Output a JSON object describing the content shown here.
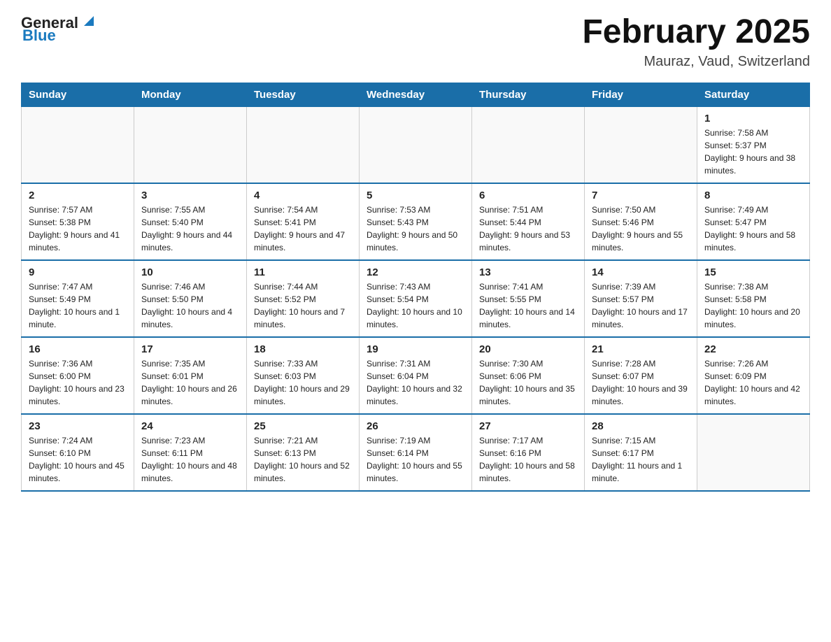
{
  "header": {
    "logo_general": "General",
    "logo_blue": "Blue",
    "title": "February 2025",
    "subtitle": "Mauraz, Vaud, Switzerland"
  },
  "weekdays": [
    "Sunday",
    "Monday",
    "Tuesday",
    "Wednesday",
    "Thursday",
    "Friday",
    "Saturday"
  ],
  "weeks": [
    [
      {
        "day": "",
        "info": ""
      },
      {
        "day": "",
        "info": ""
      },
      {
        "day": "",
        "info": ""
      },
      {
        "day": "",
        "info": ""
      },
      {
        "day": "",
        "info": ""
      },
      {
        "day": "",
        "info": ""
      },
      {
        "day": "1",
        "info": "Sunrise: 7:58 AM\nSunset: 5:37 PM\nDaylight: 9 hours and 38 minutes."
      }
    ],
    [
      {
        "day": "2",
        "info": "Sunrise: 7:57 AM\nSunset: 5:38 PM\nDaylight: 9 hours and 41 minutes."
      },
      {
        "day": "3",
        "info": "Sunrise: 7:55 AM\nSunset: 5:40 PM\nDaylight: 9 hours and 44 minutes."
      },
      {
        "day": "4",
        "info": "Sunrise: 7:54 AM\nSunset: 5:41 PM\nDaylight: 9 hours and 47 minutes."
      },
      {
        "day": "5",
        "info": "Sunrise: 7:53 AM\nSunset: 5:43 PM\nDaylight: 9 hours and 50 minutes."
      },
      {
        "day": "6",
        "info": "Sunrise: 7:51 AM\nSunset: 5:44 PM\nDaylight: 9 hours and 53 minutes."
      },
      {
        "day": "7",
        "info": "Sunrise: 7:50 AM\nSunset: 5:46 PM\nDaylight: 9 hours and 55 minutes."
      },
      {
        "day": "8",
        "info": "Sunrise: 7:49 AM\nSunset: 5:47 PM\nDaylight: 9 hours and 58 minutes."
      }
    ],
    [
      {
        "day": "9",
        "info": "Sunrise: 7:47 AM\nSunset: 5:49 PM\nDaylight: 10 hours and 1 minute."
      },
      {
        "day": "10",
        "info": "Sunrise: 7:46 AM\nSunset: 5:50 PM\nDaylight: 10 hours and 4 minutes."
      },
      {
        "day": "11",
        "info": "Sunrise: 7:44 AM\nSunset: 5:52 PM\nDaylight: 10 hours and 7 minutes."
      },
      {
        "day": "12",
        "info": "Sunrise: 7:43 AM\nSunset: 5:54 PM\nDaylight: 10 hours and 10 minutes."
      },
      {
        "day": "13",
        "info": "Sunrise: 7:41 AM\nSunset: 5:55 PM\nDaylight: 10 hours and 14 minutes."
      },
      {
        "day": "14",
        "info": "Sunrise: 7:39 AM\nSunset: 5:57 PM\nDaylight: 10 hours and 17 minutes."
      },
      {
        "day": "15",
        "info": "Sunrise: 7:38 AM\nSunset: 5:58 PM\nDaylight: 10 hours and 20 minutes."
      }
    ],
    [
      {
        "day": "16",
        "info": "Sunrise: 7:36 AM\nSunset: 6:00 PM\nDaylight: 10 hours and 23 minutes."
      },
      {
        "day": "17",
        "info": "Sunrise: 7:35 AM\nSunset: 6:01 PM\nDaylight: 10 hours and 26 minutes."
      },
      {
        "day": "18",
        "info": "Sunrise: 7:33 AM\nSunset: 6:03 PM\nDaylight: 10 hours and 29 minutes."
      },
      {
        "day": "19",
        "info": "Sunrise: 7:31 AM\nSunset: 6:04 PM\nDaylight: 10 hours and 32 minutes."
      },
      {
        "day": "20",
        "info": "Sunrise: 7:30 AM\nSunset: 6:06 PM\nDaylight: 10 hours and 35 minutes."
      },
      {
        "day": "21",
        "info": "Sunrise: 7:28 AM\nSunset: 6:07 PM\nDaylight: 10 hours and 39 minutes."
      },
      {
        "day": "22",
        "info": "Sunrise: 7:26 AM\nSunset: 6:09 PM\nDaylight: 10 hours and 42 minutes."
      }
    ],
    [
      {
        "day": "23",
        "info": "Sunrise: 7:24 AM\nSunset: 6:10 PM\nDaylight: 10 hours and 45 minutes."
      },
      {
        "day": "24",
        "info": "Sunrise: 7:23 AM\nSunset: 6:11 PM\nDaylight: 10 hours and 48 minutes."
      },
      {
        "day": "25",
        "info": "Sunrise: 7:21 AM\nSunset: 6:13 PM\nDaylight: 10 hours and 52 minutes."
      },
      {
        "day": "26",
        "info": "Sunrise: 7:19 AM\nSunset: 6:14 PM\nDaylight: 10 hours and 55 minutes."
      },
      {
        "day": "27",
        "info": "Sunrise: 7:17 AM\nSunset: 6:16 PM\nDaylight: 10 hours and 58 minutes."
      },
      {
        "day": "28",
        "info": "Sunrise: 7:15 AM\nSunset: 6:17 PM\nDaylight: 11 hours and 1 minute."
      },
      {
        "day": "",
        "info": ""
      }
    ]
  ]
}
